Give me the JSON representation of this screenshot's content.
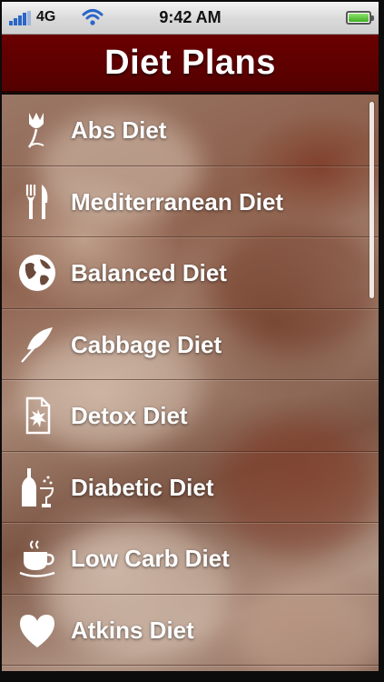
{
  "status_bar": {
    "carrier": "4G",
    "time": "9:42 AM",
    "icons": [
      "signal-bars-icon",
      "wifi-icon",
      "battery-icon"
    ]
  },
  "header": {
    "title": "Diet Plans"
  },
  "diet_list": [
    {
      "label": "Abs Diet",
      "icon": "tulip-icon"
    },
    {
      "label": "Mediterranean Diet",
      "icon": "fork-knife-icon"
    },
    {
      "label": "Balanced Diet",
      "icon": "globe-icon"
    },
    {
      "label": "Cabbage Diet",
      "icon": "leaf-icon"
    },
    {
      "label": "Detox Diet",
      "icon": "document-burst-icon"
    },
    {
      "label": "Diabetic Diet",
      "icon": "bottle-glass-icon"
    },
    {
      "label": "Low Carb Diet",
      "icon": "coffee-cup-icon"
    },
    {
      "label": "Atkins Diet",
      "icon": "heart-icon"
    }
  ],
  "colors": {
    "header_bg": "#5f0000",
    "signal_blue": "#2c66c9",
    "battery_green": "#3fae23"
  }
}
